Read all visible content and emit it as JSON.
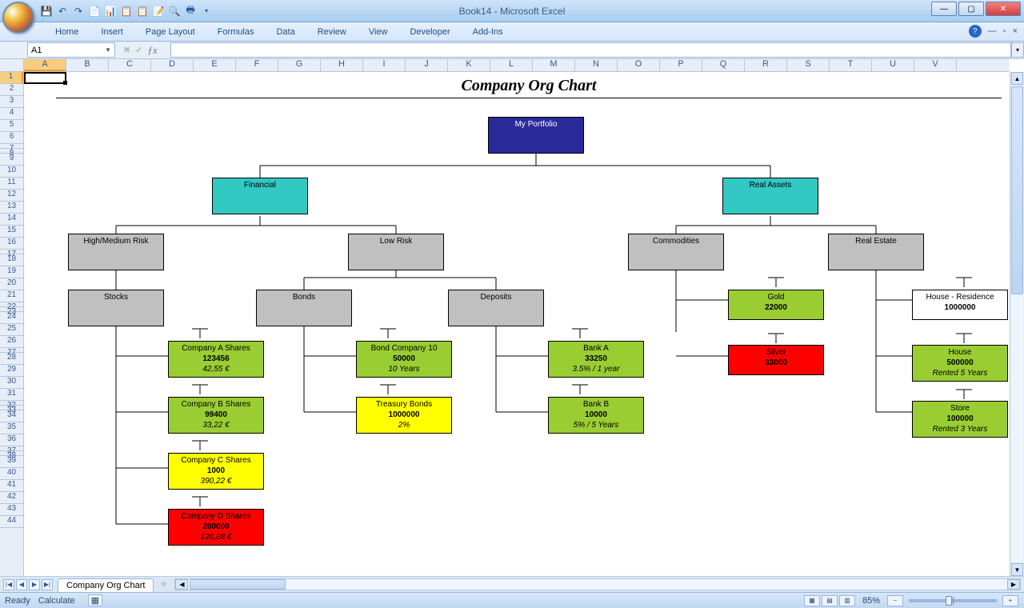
{
  "app": {
    "title": "Book14 - Microsoft Excel"
  },
  "ribbon": {
    "tabs": [
      "Home",
      "Insert",
      "Page Layout",
      "Formulas",
      "Data",
      "Review",
      "View",
      "Developer",
      "Add-Ins"
    ]
  },
  "nameBox": "A1",
  "columns": [
    "A",
    "B",
    "C",
    "D",
    "E",
    "F",
    "G",
    "H",
    "I",
    "J",
    "K",
    "L",
    "M",
    "N",
    "O",
    "P",
    "Q",
    "R",
    "S",
    "T",
    "U",
    "V"
  ],
  "chartTitle": "Company Org Chart",
  "nodes": {
    "root": {
      "t": "My Portfolio"
    },
    "fin": {
      "t": "Financial"
    },
    "real": {
      "t": "Real Assets"
    },
    "hmrisk": {
      "t": "High/Medium Risk"
    },
    "lrisk": {
      "t": "Low Risk"
    },
    "comm": {
      "t": "Commodities"
    },
    "restate": {
      "t": "Real Estate"
    },
    "stocks": {
      "t": "Stocks"
    },
    "bonds": {
      "t": "Bonds"
    },
    "deposits": {
      "t": "Deposits"
    },
    "gold": {
      "t": "Gold",
      "v": "22000"
    },
    "houseRes": {
      "t": "House - Residence",
      "v": "1000000"
    },
    "silver": {
      "t": "Silver",
      "v": "33000"
    },
    "compA": {
      "t": "Company A Shares",
      "v": "123456",
      "d": "42,55 €"
    },
    "compB": {
      "t": "Company B Shares",
      "v": "99400",
      "d": "33,22 €"
    },
    "compC": {
      "t": "Company C Shares",
      "v": "1000",
      "d": "390,22 €"
    },
    "compD": {
      "t": "Company D Shares",
      "v": "200000",
      "d": "120,88 €"
    },
    "bond10": {
      "t": "Bond Company 10",
      "v": "50000",
      "d": "10 Years"
    },
    "tbonds": {
      "t": "Treasury Bonds",
      "v": "1000000",
      "d": "2%"
    },
    "bankA": {
      "t": "Bank A",
      "v": "33250",
      "d": "3.5% / 1 year"
    },
    "bankB": {
      "t": "Bank B",
      "v": "10000",
      "d": "5% / 5 Years"
    },
    "house": {
      "t": "House",
      "v": "500000",
      "d": "Rented 5 Years"
    },
    "store": {
      "t": "Store",
      "v": "100000",
      "d": "Rented 3 Years"
    }
  },
  "sheetTab": "Company Org Chart",
  "status": {
    "ready": "Ready",
    "calc": "Calculate",
    "zoom": "85%"
  }
}
